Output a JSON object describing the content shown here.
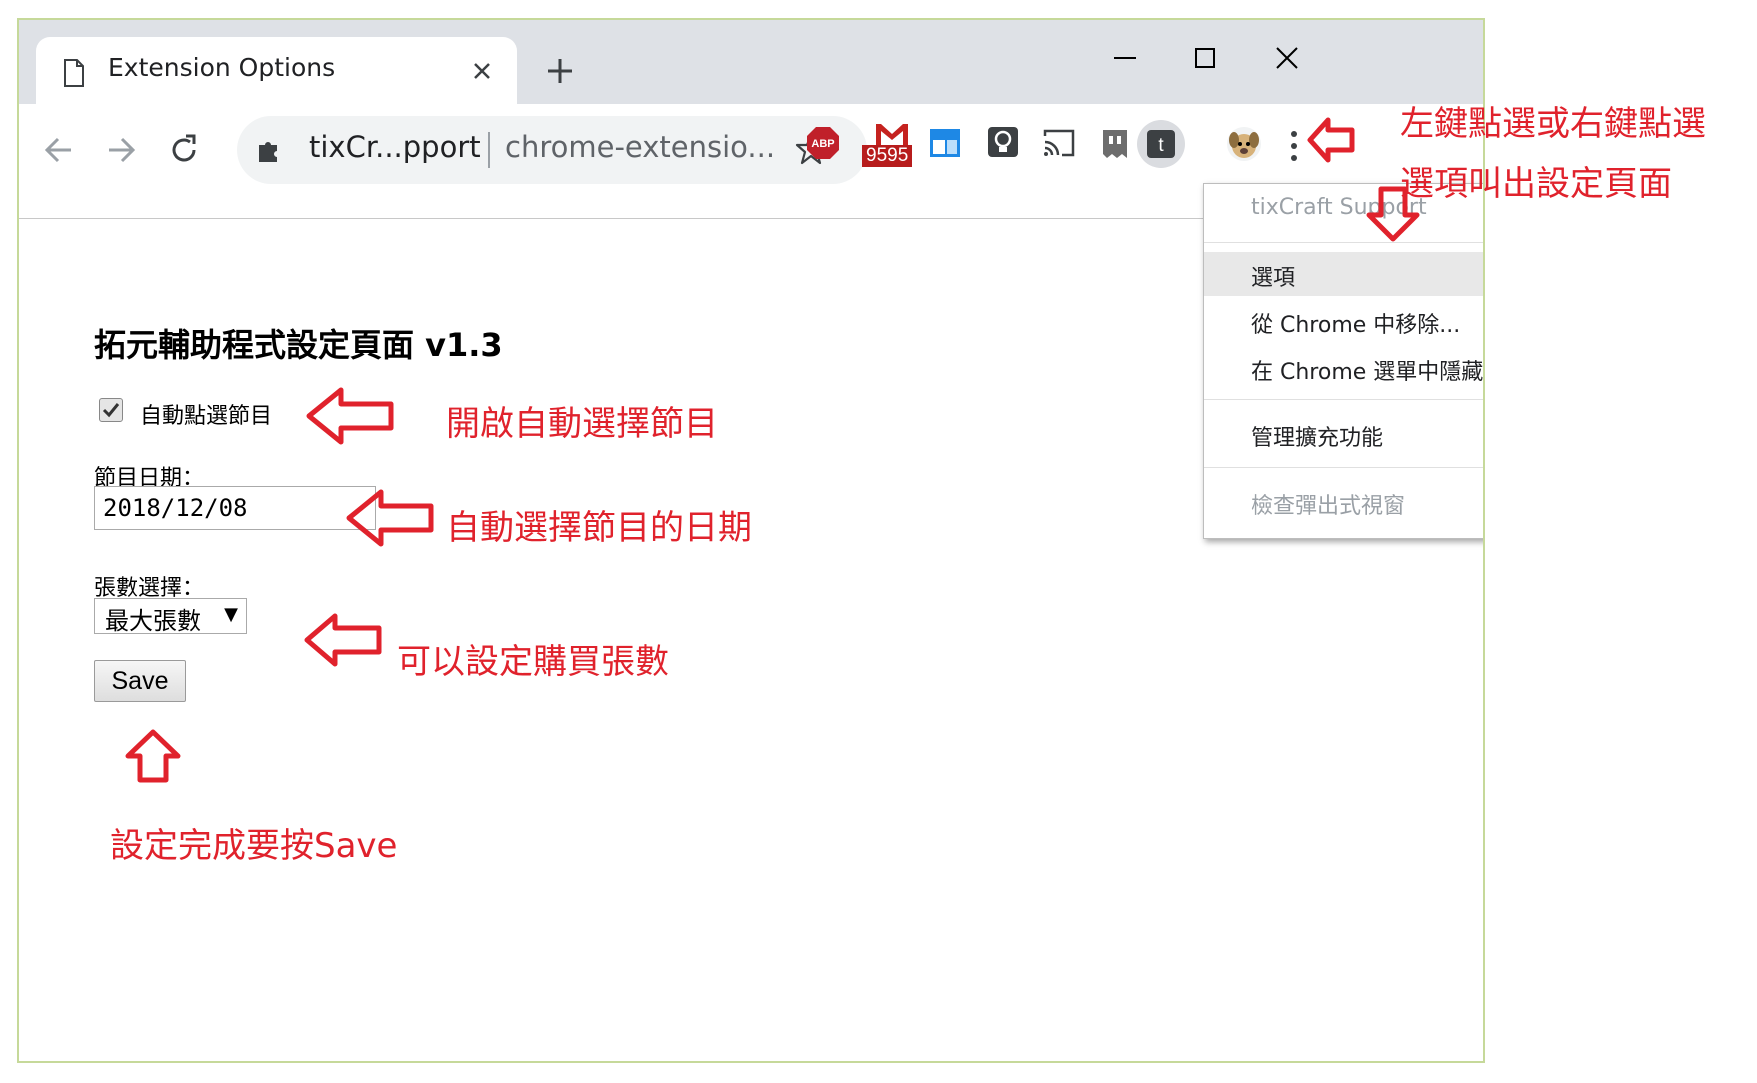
{
  "browser": {
    "tab_title": "Extension Options",
    "omnibox": {
      "extension_name": "tixCr...pport",
      "url": "chrome-extensio..."
    },
    "extensions": {
      "abp_label": "ABP",
      "gmail_count": "9595",
      "active_ext_letter": "t"
    }
  },
  "page": {
    "heading": "拓元輔助程式設定頁面 v1.3",
    "auto_select_label": "自動點選節目",
    "auto_select_checked": true,
    "date_label": "節目日期：",
    "date_value": "2018/12/08",
    "count_label": "張數選擇：",
    "count_value": "最大張數",
    "save_label": "Save"
  },
  "context_menu": {
    "header": "tixCraft Support",
    "items": [
      {
        "label": "選項",
        "highlighted": true,
        "disabled": false
      },
      {
        "label": "從 Chrome 中移除...",
        "highlighted": false,
        "disabled": false
      },
      {
        "label": "在 Chrome 選單中隱藏",
        "highlighted": false,
        "disabled": false
      },
      {
        "label": "管理擴充功能",
        "highlighted": false,
        "disabled": false
      },
      {
        "label": "檢查彈出式視窗",
        "highlighted": false,
        "disabled": true
      }
    ]
  },
  "annotations": {
    "top_right_line1": "左鍵點選或右鍵點選",
    "top_right_line2": "選項叫出設定頁面",
    "auto_select": "開啟自動選擇節目",
    "date": "自動選擇節目的日期",
    "count": "可以設定購買張數",
    "save": "設定完成要按Save"
  },
  "colors": {
    "annotation_red": "#e0222c",
    "window_border": "#c6d99a",
    "tabstrip_bg": "#dee1e6"
  }
}
